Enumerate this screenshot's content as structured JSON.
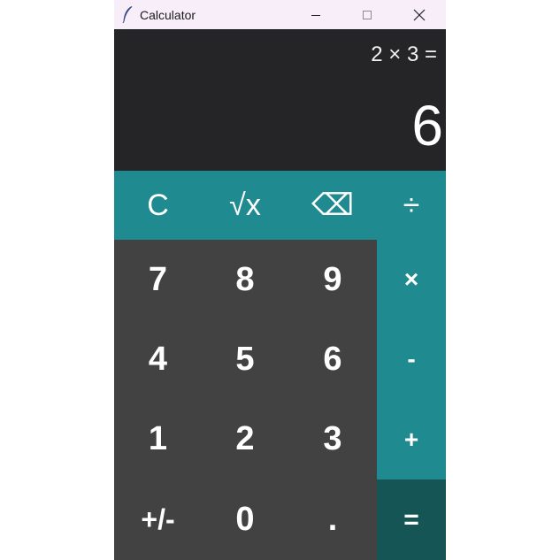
{
  "window": {
    "title": "Calculator",
    "icon": "feather-icon"
  },
  "display": {
    "expression": "2 × 3 =",
    "result": "6"
  },
  "keys": {
    "clear": "C",
    "sqrt": "√x",
    "backspace": "⌫",
    "divide": "÷",
    "seven": "7",
    "eight": "8",
    "nine": "9",
    "multiply": "×",
    "four": "4",
    "five": "5",
    "six": "6",
    "minus": "-",
    "one": "1",
    "two": "2",
    "three": "3",
    "plus": "+",
    "negate": "+/-",
    "zero": "0",
    "decimal": ".",
    "equals": "="
  },
  "colors": {
    "display_bg": "#252527",
    "function_key": "#1f8a90",
    "number_key": "#424242",
    "equals_key": "#155556",
    "titlebar": "#f7eefa"
  }
}
